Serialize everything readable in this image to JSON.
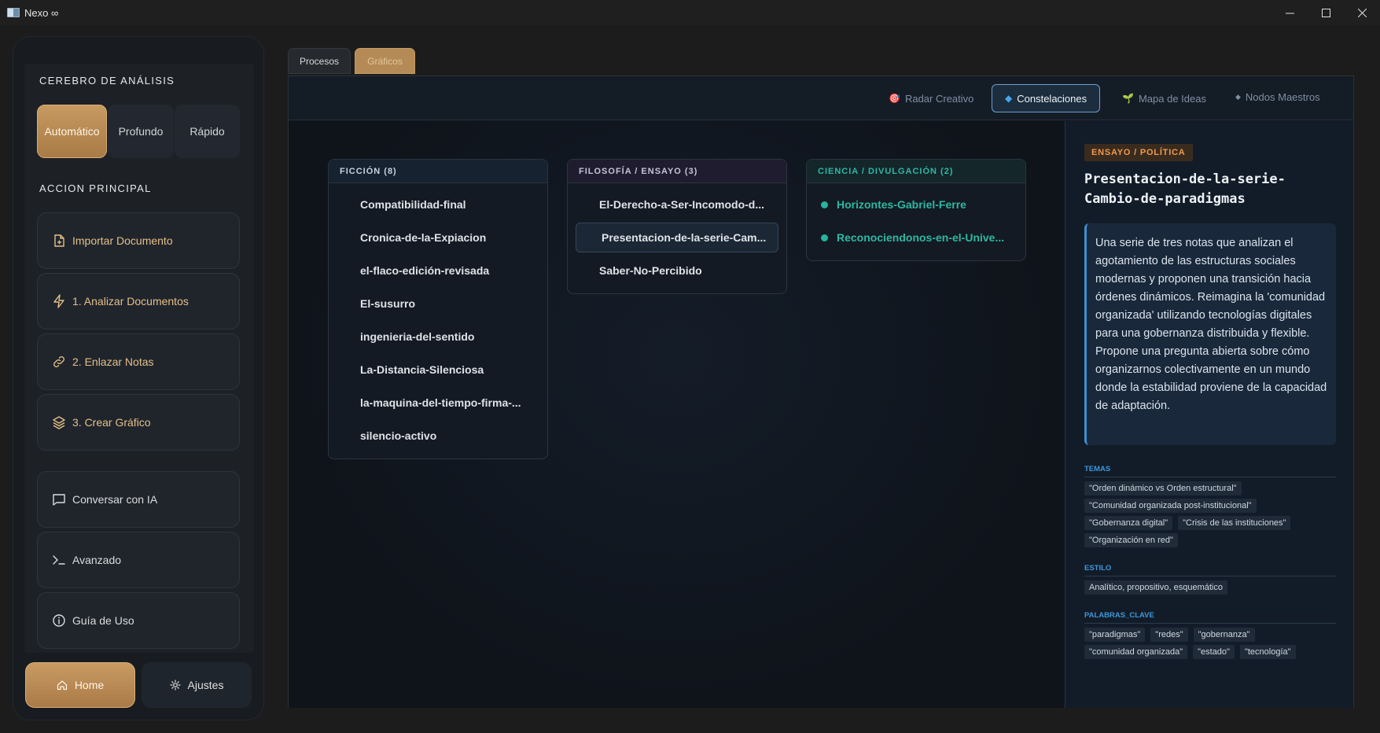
{
  "window": {
    "title": "Nexo ∞",
    "controls": [
      "minimize",
      "maximize",
      "close"
    ]
  },
  "sidebar": {
    "brain_title": "CEREBRO DE ANÁLISIS",
    "modes": [
      {
        "label": "Automático",
        "active": true
      },
      {
        "label": "Profundo",
        "active": false
      },
      {
        "label": "Rápido",
        "active": false
      }
    ],
    "main_action_title": "ACCION PRINCIPAL",
    "actions": [
      {
        "label": "Importar Documento",
        "icon": "file-plus-icon"
      },
      {
        "label": "1. Analizar Documentos",
        "icon": "lightning-icon"
      },
      {
        "label": "2. Enlazar Notas",
        "icon": "link-icon"
      },
      {
        "label": "3. Crear Gráfico",
        "icon": "layers-icon"
      }
    ],
    "secondary": [
      {
        "label": "Conversar con IA",
        "icon": "chat-icon"
      },
      {
        "label": "Avanzado",
        "icon": "terminal-icon"
      },
      {
        "label": "Guía de Uso",
        "icon": "info-icon"
      }
    ],
    "home_label": "Home",
    "settings_label": "Ajustes"
  },
  "tabs": [
    {
      "label": "Procesos",
      "active": false
    },
    {
      "label": "Gráficos",
      "active": true
    }
  ],
  "views": [
    {
      "label": "Radar Creativo",
      "glyph": "🎯",
      "active": false
    },
    {
      "label": "Constelaciones",
      "glyph": "◆",
      "active": true
    },
    {
      "label": "Mapa de Ideas",
      "glyph": "🌱",
      "active": false
    },
    {
      "label": "Nodos Maestros",
      "glyph": "◆",
      "active": false
    }
  ],
  "groups": [
    {
      "title": "FICCIÓN (8)",
      "color": "#c9d3dd",
      "items": [
        "Compatibilidad-final",
        "Cronica-de-la-Expiacion",
        "el-flaco-edición-revisada",
        "El-susurro",
        "ingenieria-del-sentido",
        "La-Distancia-Silenciosa",
        "la-maquina-del-tiempo-firma-...",
        "silencio-activo"
      ]
    },
    {
      "title": "FILOSOFÍA / ENSAYO (3)",
      "color": "#c9c3d9",
      "items": [
        "El-Derecho-a-Ser-Incomodo-d...",
        "Presentacion-de-la-serie-Cam...",
        "Saber-No-Percibido"
      ],
      "selected_index": 1
    },
    {
      "title": "CIENCIA / DIVULGACIÓN (2)",
      "color": "#2fb7a3",
      "items": [
        "Horizontes-Gabriel-Ferre",
        "Reconociendonos-en-el-Unive..."
      ]
    }
  ],
  "detail": {
    "category": "ENSAYO / POLÍTICA",
    "title": "Presentacion-de-la-serie-Cambio-de-paradigmas",
    "summary": "Una serie de tres notas que analizan el agotamiento de las estructuras sociales modernas y proponen una transición hacia órdenes dinámicos. Reimagina la 'comunidad organizada' utilizando tecnologías digitales para una gobernanza distribuida y flexible. Propone una pregunta abierta sobre cómo organizarnos colectivamente en un mundo donde la estabilidad proviene de la capacidad de adaptación.",
    "themes_label": "TEMAS",
    "themes": [
      "\"Orden dinámico vs Orden estructural\"",
      "\"Comunidad organizada post-institucional\"",
      "\"Gobernanza digital\"",
      "\"Crisis de las instituciones\"",
      "\"Organización en red\""
    ],
    "style_label": "ESTILO",
    "style": [
      "Analítico, propositivo, esquemático"
    ],
    "keywords_label": "PALABRAS_CLAVE",
    "keywords": [
      "\"paradigmas\"",
      "\"redes\"",
      "\"gobernanza\"",
      "\"comunidad organizada\"",
      "\"estado\"",
      "\"tecnología\""
    ]
  },
  "colors": {
    "accent_gold": "#c79a62",
    "accent_blue": "#3f8fd5",
    "teal": "#2fb7a3",
    "category_orange": "#f19a4b"
  }
}
